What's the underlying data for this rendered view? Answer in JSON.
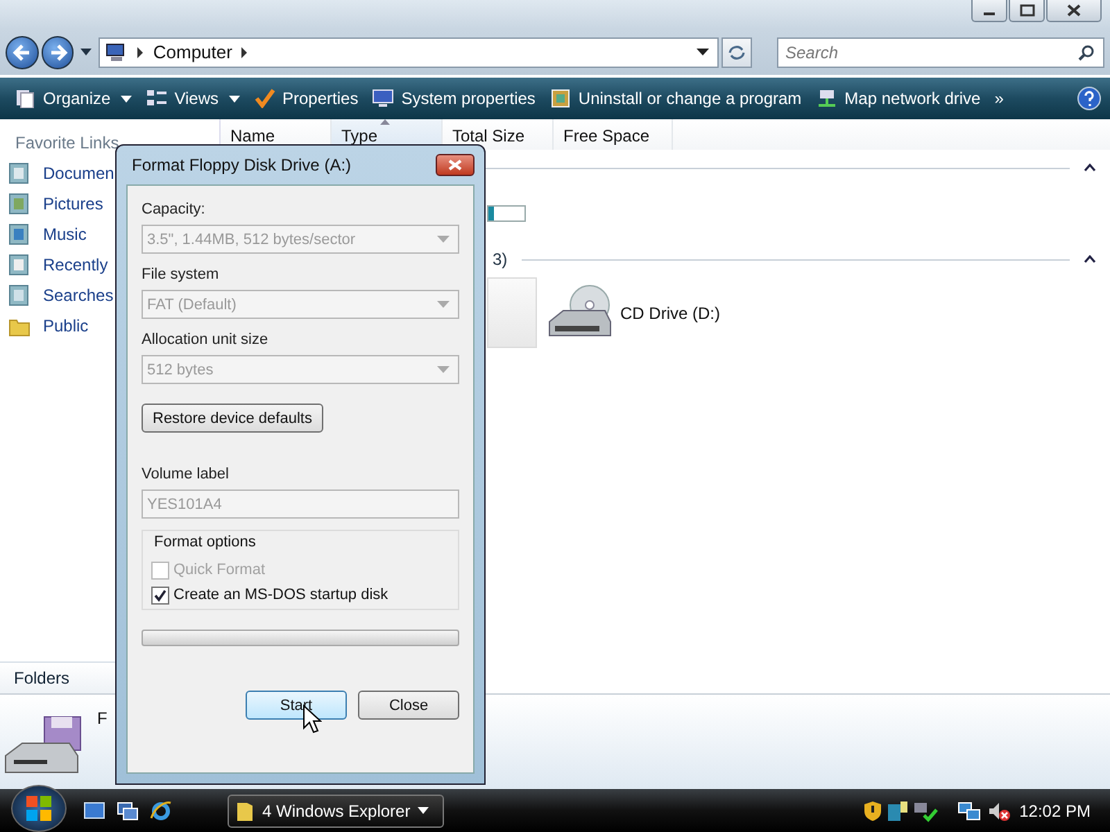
{
  "address_bar": {
    "path": "Computer",
    "search": {
      "placeholder": "Search"
    }
  },
  "toolbar": {
    "items": [
      {
        "label": "Organize",
        "menu": true
      },
      {
        "label": "Views",
        "menu": true
      },
      {
        "label": "Properties",
        "menu": false
      },
      {
        "label": "System properties",
        "menu": false
      },
      {
        "label": "Uninstall or change a program",
        "menu": false
      },
      {
        "label": "Map network drive",
        "menu": false
      }
    ],
    "overflow": "»"
  },
  "columns": [
    {
      "label": "Name",
      "sorted": false
    },
    {
      "label": "Type",
      "sorted": true
    },
    {
      "label": "Total Size",
      "sorted": false
    },
    {
      "label": "Free Space",
      "sorted": false
    }
  ],
  "sidebar": {
    "title": "Favorite Links",
    "items": [
      "Documen",
      "Pictures",
      "Music",
      "Recently",
      "Searches",
      "Public"
    ],
    "footer": "Folders"
  },
  "content": {
    "group_fragment": "3)",
    "items": [
      {
        "label": "CD Drive (D:)"
      }
    ],
    "details_fragment": "F"
  },
  "dialog": {
    "title": "Format Floppy Disk Drive (A:)",
    "fields": [
      {
        "label": "Capacity:",
        "value": "3.5\",  1.44MB, 512 bytes/sector",
        "disabled": true
      },
      {
        "label": "File system",
        "value": "FAT (Default)",
        "disabled": true
      },
      {
        "label": "Allocation unit size",
        "value": "512 bytes",
        "disabled": true
      }
    ],
    "restore_button": "Restore device defaults",
    "volume_label": {
      "label": "Volume label",
      "value": "YES101A4",
      "disabled": true
    },
    "options": {
      "title": "Format options",
      "items": [
        {
          "label": "Quick Format",
          "checked": false,
          "disabled": true
        },
        {
          "label": "Create an MS-DOS startup disk",
          "checked": true,
          "disabled": false
        }
      ]
    },
    "progress": {
      "level": 0
    },
    "buttons": [
      {
        "label": "Start",
        "default": true
      },
      {
        "label": "Close",
        "default": false
      }
    ]
  },
  "taskbar": {
    "tasks": [
      {
        "label": "4 Windows Explorer",
        "selected": true
      }
    ],
    "clock": "12:02 PM"
  }
}
